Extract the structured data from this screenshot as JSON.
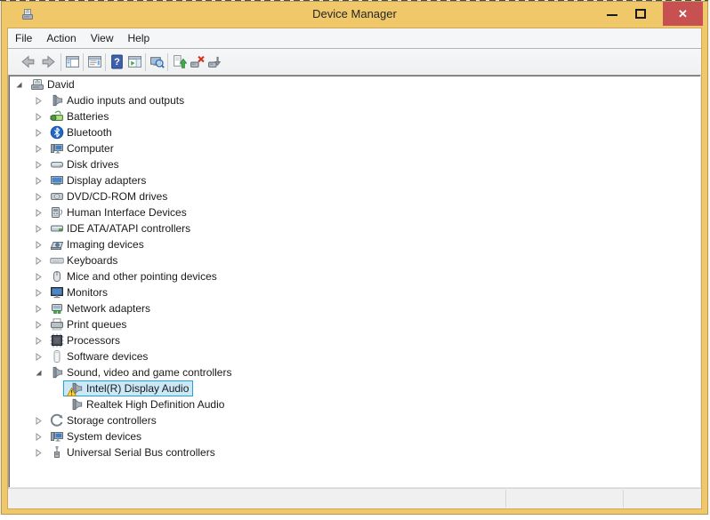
{
  "window": {
    "title": "Device Manager"
  },
  "titlebar_buttons": {
    "minimize": "minimize",
    "maximize": "maximize",
    "close": "close"
  },
  "menu": {
    "items": [
      {
        "label": "File"
      },
      {
        "label": "Action"
      },
      {
        "label": "View"
      },
      {
        "label": "Help"
      }
    ]
  },
  "toolbar": {
    "buttons": [
      {
        "type": "button",
        "name": "back",
        "icon": "back-arrow-icon"
      },
      {
        "type": "button",
        "name": "forward",
        "icon": "forward-arrow-icon"
      },
      {
        "type": "separator"
      },
      {
        "type": "button",
        "name": "show-console-tree",
        "icon": "console-tree-icon"
      },
      {
        "type": "separator"
      },
      {
        "type": "button",
        "name": "properties",
        "icon": "properties-icon"
      },
      {
        "type": "separator"
      },
      {
        "type": "button",
        "name": "help",
        "icon": "help-icon"
      },
      {
        "type": "button",
        "name": "show-action-pane",
        "icon": "action-pane-icon"
      },
      {
        "type": "separator"
      },
      {
        "type": "button",
        "name": "scan-for-hardware-changes",
        "icon": "scan-hardware-icon"
      },
      {
        "type": "separator"
      },
      {
        "type": "button",
        "name": "update-driver",
        "icon": "update-driver-icon"
      },
      {
        "type": "button",
        "name": "uninstall-device",
        "icon": "uninstall-device-icon"
      },
      {
        "type": "button",
        "name": "disable-device",
        "icon": "disable-device-icon"
      }
    ]
  },
  "tree": {
    "items": [
      {
        "label": "David",
        "level": 0,
        "state": "expanded",
        "icon": "computer-root-icon"
      },
      {
        "label": "Audio inputs and outputs",
        "level": 1,
        "state": "collapsed",
        "icon": "speaker-icon"
      },
      {
        "label": "Batteries",
        "level": 1,
        "state": "collapsed",
        "icon": "battery-icon"
      },
      {
        "label": "Bluetooth",
        "level": 1,
        "state": "collapsed",
        "icon": "bluetooth-icon"
      },
      {
        "label": "Computer",
        "level": 1,
        "state": "collapsed",
        "icon": "computer-icon"
      },
      {
        "label": "Disk drives",
        "level": 1,
        "state": "collapsed",
        "icon": "disk-drive-icon"
      },
      {
        "label": "Display adapters",
        "level": 1,
        "state": "collapsed",
        "icon": "display-adapter-icon"
      },
      {
        "label": "DVD/CD-ROM drives",
        "level": 1,
        "state": "collapsed",
        "icon": "dvd-drive-icon"
      },
      {
        "label": "Human Interface Devices",
        "level": 1,
        "state": "collapsed",
        "icon": "hid-icon"
      },
      {
        "label": "IDE ATA/ATAPI controllers",
        "level": 1,
        "state": "collapsed",
        "icon": "ide-controller-icon"
      },
      {
        "label": "Imaging devices",
        "level": 1,
        "state": "collapsed",
        "icon": "imaging-device-icon"
      },
      {
        "label": "Keyboards",
        "level": 1,
        "state": "collapsed",
        "icon": "keyboard-icon"
      },
      {
        "label": "Mice and other pointing devices",
        "level": 1,
        "state": "collapsed",
        "icon": "mouse-icon"
      },
      {
        "label": "Monitors",
        "level": 1,
        "state": "collapsed",
        "icon": "monitor-icon"
      },
      {
        "label": "Network adapters",
        "level": 1,
        "state": "collapsed",
        "icon": "network-adapter-icon"
      },
      {
        "label": "Print queues",
        "level": 1,
        "state": "collapsed",
        "icon": "printer-icon"
      },
      {
        "label": "Processors",
        "level": 1,
        "state": "collapsed",
        "icon": "processor-icon"
      },
      {
        "label": "Software devices",
        "level": 1,
        "state": "collapsed",
        "icon": "software-device-icon"
      },
      {
        "label": "Sound, video and game controllers",
        "level": 1,
        "state": "expanded",
        "icon": "speaker-icon"
      },
      {
        "label": "Intel(R) Display Audio",
        "level": 2,
        "state": "leaf",
        "icon": "speaker-icon",
        "badge": "warning",
        "selected": true
      },
      {
        "label": "Realtek High Definition Audio",
        "level": 2,
        "state": "leaf",
        "icon": "speaker-icon"
      },
      {
        "label": "Storage controllers",
        "level": 1,
        "state": "collapsed",
        "icon": "storage-controller-icon"
      },
      {
        "label": "System devices",
        "level": 1,
        "state": "collapsed",
        "icon": "system-device-icon"
      },
      {
        "label": "Universal Serial Bus controllers",
        "level": 1,
        "state": "collapsed",
        "icon": "usb-icon"
      }
    ]
  },
  "status_bar": {
    "text": ""
  },
  "colors": {
    "titlebar": "#f0c869",
    "close_button": "#c75050",
    "selection_bg": "#cbe8f6",
    "selection_border": "#26a0da",
    "chrome_bg": "#f5f6f7",
    "status_bg": "#f0f0f0"
  }
}
